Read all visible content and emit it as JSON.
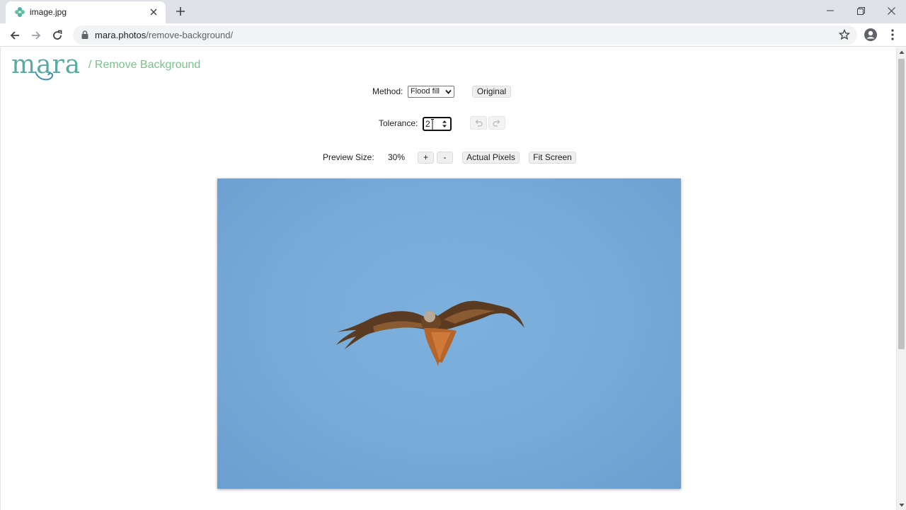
{
  "browser": {
    "tab_title": "image.jpg",
    "url_host": "mara.photos",
    "url_path": "/remove-background/"
  },
  "header": {
    "logo_text": "mara",
    "crumb": "/ Remove Background"
  },
  "controls": {
    "method_label": "Method:",
    "method_value": "Flood fill",
    "original_button": "Original",
    "tolerance_label": "Tolerance:",
    "tolerance_value": "2",
    "preview_size_label": "Preview Size:",
    "preview_size_value": "30%",
    "zoom_in": "+",
    "zoom_out": "-",
    "actual_pixels": "Actual Pixels",
    "fit_screen": "Fit Screen"
  },
  "icons": [
    "pinwheel-favicon-icon",
    "close-icon",
    "plus-icon",
    "minimize-icon",
    "restore-icon",
    "back-icon",
    "forward-icon",
    "reload-icon",
    "lock-icon",
    "star-icon",
    "profile-icon",
    "kebab-menu-icon",
    "undo-icon",
    "redo-icon",
    "chevron-down-icon"
  ],
  "colors": {
    "logo": "#5aa9a3",
    "crumb": "#7cc08a",
    "sky": "#78abd8"
  }
}
